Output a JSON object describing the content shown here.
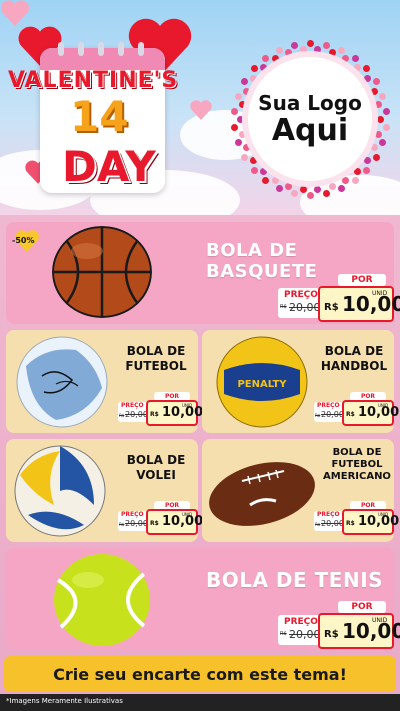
{
  "header": {
    "valentines_text": "VALENTINE'S",
    "number": "14",
    "day_text": "DAY",
    "logo_line1": "Sua Logo",
    "logo_line2": "Aqui"
  },
  "discount_badge": "-50%",
  "products": [
    {
      "name": "BOLA DE BASQUETE",
      "por": "POR",
      "preco_label": "PREÇO",
      "old_prefix": "R$",
      "old_price": "20,00",
      "new_prefix": "R$",
      "new_price": "10,00",
      "unid": "UNID"
    },
    {
      "name_l1": "BOLA DE",
      "name_l2": "FUTEBOL",
      "por": "POR",
      "preco_label": "PREÇO",
      "old_prefix": "R$",
      "old_price": "20,00",
      "new_prefix": "R$",
      "new_price": "10,00",
      "unid": "UNID"
    },
    {
      "name_l1": "BOLA DE",
      "name_l2": "HANDBOL",
      "por": "POR",
      "preco_label": "PREÇO",
      "old_prefix": "R$",
      "old_price": "20,00",
      "new_prefix": "R$",
      "new_price": "10,00",
      "unid": "UNID"
    },
    {
      "name_l1": "BOLA DE",
      "name_l2": "VOLEI",
      "por": "POR",
      "preco_label": "PREÇO",
      "old_prefix": "R$",
      "old_price": "20,00",
      "new_prefix": "R$",
      "new_price": "10,00",
      "unid": "UNID"
    },
    {
      "name_l1": "BOLA DE",
      "name_l2": "FUTEBOL",
      "name_l3": "AMERICANO",
      "por": "POR",
      "preco_label": "PREÇO",
      "old_prefix": "R$",
      "old_price": "20,00",
      "new_prefix": "R$",
      "new_price": "10,00",
      "unid": "UNID"
    },
    {
      "name": "BOLA DE TENIS",
      "por": "POR",
      "preco_label": "PREÇO",
      "old_prefix": "R$",
      "old_price": "20,00",
      "new_prefix": "R$",
      "new_price": "10,00",
      "unid": "UNID"
    }
  ],
  "footer": {
    "cta": "Crie seu encarte com este tema!",
    "note": "*Imagens Meramente Ilustrativas"
  },
  "colors": {
    "accent_red": "#e8192c",
    "pink_card": "#f4a6c4",
    "cream_card": "#f6dfae",
    "footer_yellow": "#f6c12a"
  }
}
